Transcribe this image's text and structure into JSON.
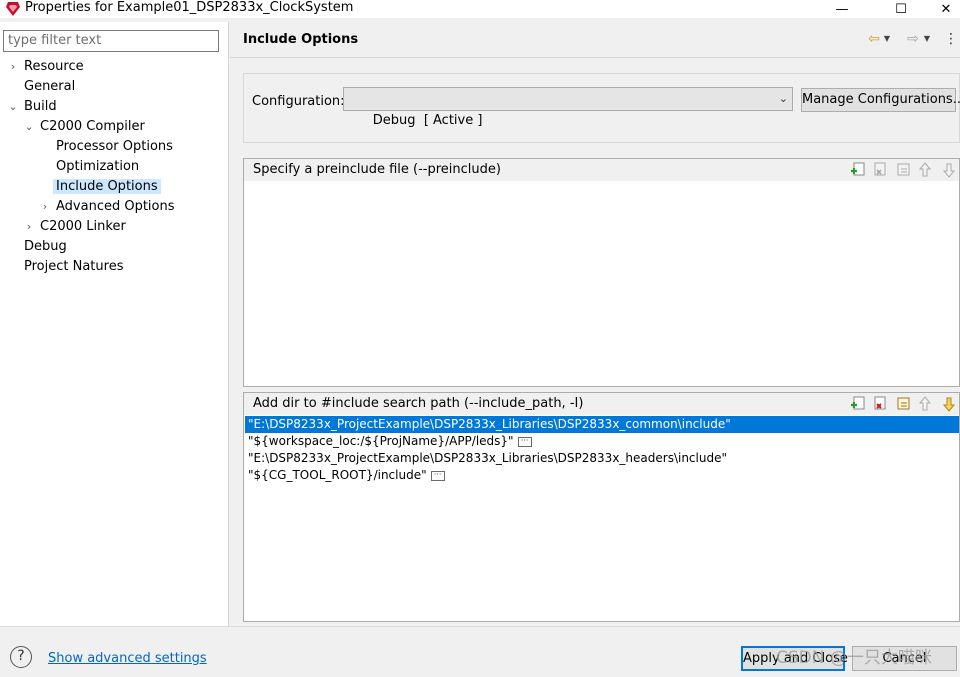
{
  "window": {
    "title": "Properties for Example01_DSP2833x_ClockSystem",
    "minimize": "—",
    "maximize": "☐",
    "close": "✕"
  },
  "filter": {
    "placeholder": "type filter text"
  },
  "tree": [
    {
      "label": "Resource",
      "expander": "›"
    },
    {
      "label": "General"
    },
    {
      "label": "Build",
      "expander": "⌄"
    },
    {
      "label": "C2000 Compiler",
      "expander": "⌄"
    },
    {
      "label": "Processor Options"
    },
    {
      "label": "Optimization"
    },
    {
      "label": "Include Options",
      "selected": true
    },
    {
      "label": "Advanced Options",
      "expander": "›"
    },
    {
      "label": "C2000 Linker",
      "expander": "›"
    },
    {
      "label": "Debug"
    },
    {
      "label": "Project Natures"
    }
  ],
  "page": {
    "title": "Include Options",
    "config_label": "Configuration:",
    "config_value": "Debug  [ Active ]",
    "manage_button": "Manage Configurations..."
  },
  "preinclude": {
    "title": "Specify a preinclude file (--preinclude)",
    "items": []
  },
  "include_path": {
    "title": "Add dir to #include search path (--include_path, -I)",
    "items": [
      "\"E:\\DSP8233x_ProjectExample\\DSP2833x_Libraries\\DSP2833x_common\\include\"",
      "\"${workspace_loc:/${ProjName}/APP/leds}\"",
      "\"E:\\DSP8233x_ProjectExample\\DSP2833x_Libraries\\DSP2833x_headers\\include\"",
      "\"${CG_TOOL_ROOT}/include\""
    ],
    "selected_index": 0
  },
  "bottom": {
    "help": "?",
    "advanced_link": "Show advanced settings",
    "apply_button": "Apply and Close",
    "cancel_button": "Cancel",
    "watermark": "CSDN @一只大喵咪"
  },
  "colors": {
    "selection": "#0078d7",
    "tree_selection": "#cce8ff",
    "link": "#0066cc"
  }
}
